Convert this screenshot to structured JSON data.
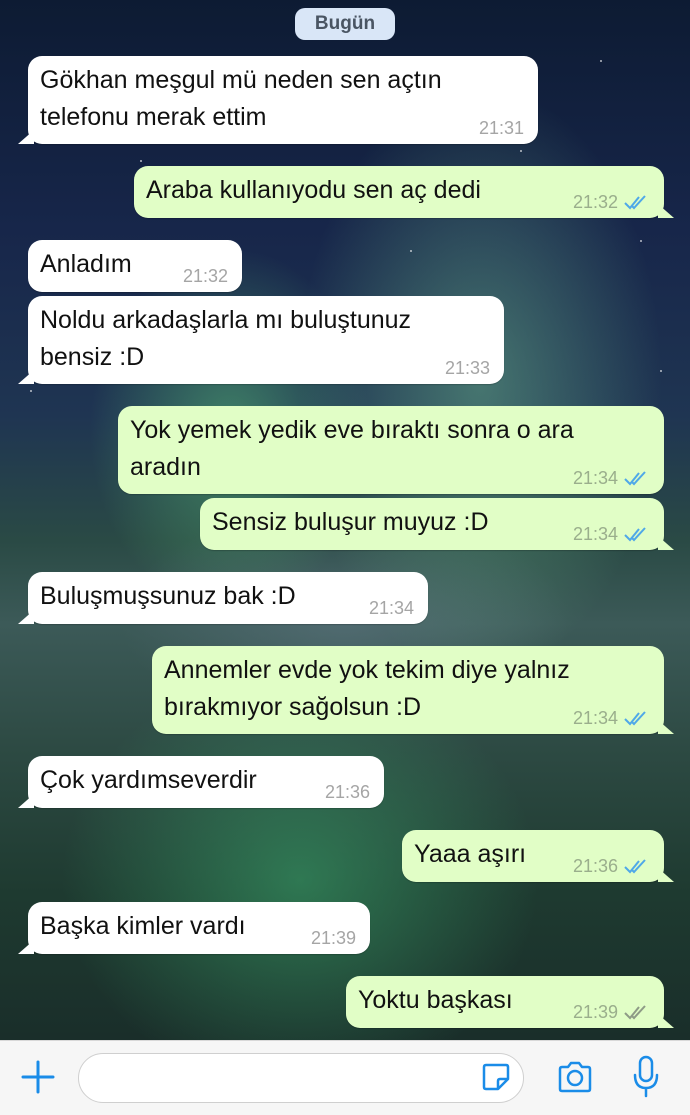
{
  "date_separator": "Bugün",
  "messages": [
    {
      "direction": "in",
      "line1": "Gökhan meşgul mü neden sen açtın",
      "line2": "telefonu merak ettim",
      "time": "21:31"
    },
    {
      "direction": "out",
      "line1": "Araba kullanıyodu sen aç dedi",
      "time": "21:32",
      "status": "read"
    },
    {
      "direction": "in",
      "line1": "Anladım",
      "time": "21:32"
    },
    {
      "direction": "in",
      "line1": "Noldu arkadaşlarla mı buluştunuz",
      "line2": "bensiz :D",
      "time": "21:33"
    },
    {
      "direction": "out",
      "line1": "Yok yemek yedik eve bıraktı sonra o ara",
      "line2": "aradın",
      "time": "21:34",
      "status": "read"
    },
    {
      "direction": "out",
      "line1": "Sensiz buluşur muyuz :D",
      "time": "21:34",
      "status": "read"
    },
    {
      "direction": "in",
      "line1": "Buluşmuşsunuz bak :D",
      "time": "21:34"
    },
    {
      "direction": "out",
      "line1": "Annemler evde yok tekim diye yalnız",
      "line2": "bırakmıyor sağolsun :D",
      "time": "21:34",
      "status": "read"
    },
    {
      "direction": "in",
      "line1": "Çok yardımseverdir",
      "time": "21:36"
    },
    {
      "direction": "out",
      "line1": "Yaaa aşırı",
      "time": "21:36",
      "status": "read"
    },
    {
      "direction": "in",
      "line1": "Başka kimler vardı",
      "time": "21:39"
    },
    {
      "direction": "out",
      "line1": "Yoktu başkası",
      "time": "21:39",
      "status": "delivered"
    }
  ],
  "composer": {
    "placeholder": "",
    "icons": [
      "plus-icon",
      "sticker-icon",
      "camera-icon",
      "microphone-icon"
    ]
  },
  "colors": {
    "incoming_bubble": "#ffffff",
    "outgoing_bubble": "#e1fec6",
    "read_ticks": "#4fa8e8",
    "delivered_ticks": "#8e9b86",
    "accent": "#1a8ce8"
  }
}
